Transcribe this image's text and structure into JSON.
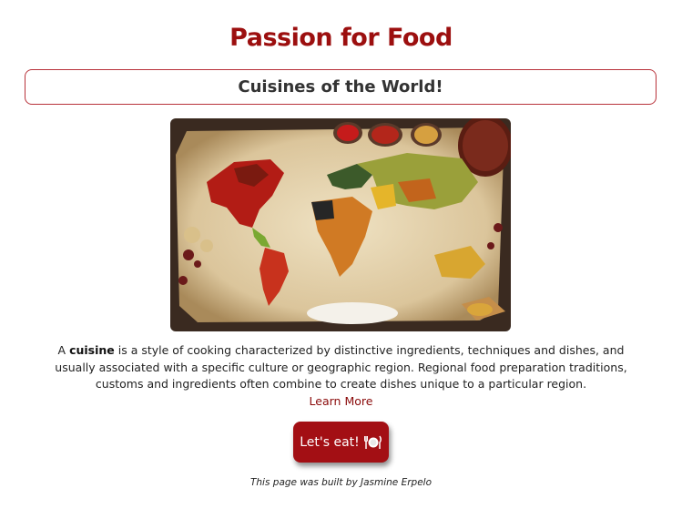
{
  "header": {
    "title": "Passion for Food"
  },
  "banner": {
    "subtitle": "Cuisines of the World!"
  },
  "hero": {
    "image": "world-map-made-of-spices"
  },
  "description": {
    "lead": "A ",
    "term": "cuisine",
    "body": " is a style of cooking characterized by distinctive ingredients, techniques and dishes, and usually associated with a specific culture or geographic region. Regional food preparation traditions, customs and ingredients often combine to create dishes unique to a particular region.",
    "link_label": "Learn More"
  },
  "cta": {
    "label": "Let's eat!",
    "icon": "plate-cutlery-icon"
  },
  "footer": {
    "credit": "This page was built by Jasmine Erpelo"
  },
  "colors": {
    "brand": "#9c0f0f",
    "button": "#a30f14",
    "border": "#b8323a",
    "link": "#8a0a0a"
  }
}
